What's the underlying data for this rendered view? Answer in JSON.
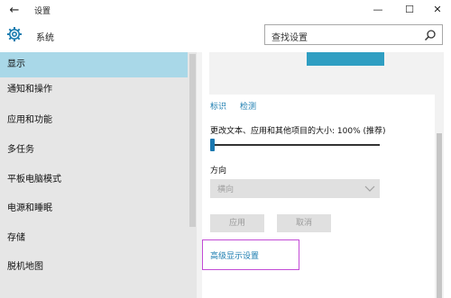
{
  "window": {
    "title": "设置",
    "back_icon": "back-arrow-icon"
  },
  "header": {
    "section_title": "系统",
    "section_icon": "gear-icon"
  },
  "search": {
    "placeholder": "查找设置",
    "icon": "search-icon"
  },
  "sidebar": {
    "items": [
      {
        "label": "显示",
        "active": true
      },
      {
        "label": "通知和操作",
        "active": false
      },
      {
        "label": "应用和功能",
        "active": false
      },
      {
        "label": "多任务",
        "active": false
      },
      {
        "label": "平板电脑模式",
        "active": false
      },
      {
        "label": "电源和睡眠",
        "active": false
      },
      {
        "label": "存储",
        "active": false
      },
      {
        "label": "脱机地图",
        "active": false
      }
    ]
  },
  "display": {
    "identify_link": "标识",
    "detect_link": "检测",
    "scale_label": "更改文本、应用和其他项目的大小: 100% (推荐)",
    "scale_value_percent": 0,
    "orientation_label": "方向",
    "orientation_value": "横向",
    "apply_button": "应用",
    "cancel_button": "取消",
    "advanced_link": "高级显示设置"
  },
  "colors": {
    "active_item": "#a9d8e8",
    "link": "#1c7db0",
    "highlight_border": "#c24bd6",
    "monitor": "#2f9ec2"
  }
}
